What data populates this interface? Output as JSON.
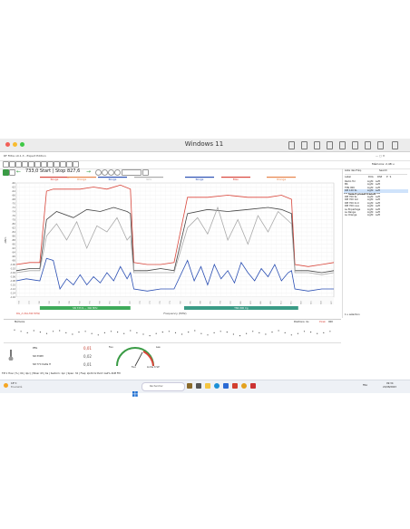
{
  "mac": {
    "title": "Windows 11",
    "menu_status": "Windows 11"
  },
  "app": {
    "title_left": "RF Filtre v0.1.3 - Expert Edition",
    "freq_controls": "733,0 Start | Stop 827,6",
    "top_right": "Mémoire: 2,48 u",
    "color_labels": [
      "Rouge",
      "Orange",
      "Rouge",
      "Gris",
      "Rouge",
      "Bleu",
      "Orange"
    ]
  },
  "chart": {
    "ylabel": "dBm",
    "xlabel": "Frequency (MHz)",
    "bottom_left_label": "RG_A (RA-M4 MHz)",
    "green_bar_1": "SN 733 R..., 340 MHz",
    "green_bar_2": "TNS 800 Cg",
    "yticks": [
      "-60",
      "-62",
      "-64",
      "-66",
      "-68",
      "-70",
      "-72",
      "-74",
      "-76",
      "-78",
      "-80",
      "-82",
      "-84",
      "-86",
      "-88",
      "-90",
      "-92",
      "-94",
      "-96",
      "-98",
      "-100",
      "-102",
      "-104",
      "-106",
      "-108",
      "-110",
      "-112",
      "-114",
      "-116"
    ]
  },
  "chart_data": {
    "type": "line",
    "xlabel": "Frequency (MHz)",
    "ylabel": "dBm",
    "ylim": [
      -116,
      -60
    ],
    "xlim": [
      733,
      827.6
    ],
    "series": [
      {
        "color": "#d9453a",
        "values": [
          [
            733,
            -100
          ],
          [
            737,
            -99
          ],
          [
            740,
            -99
          ],
          [
            742,
            -64
          ],
          [
            744,
            -63
          ],
          [
            748,
            -63
          ],
          [
            752,
            -63
          ],
          [
            756,
            -62
          ],
          [
            760,
            -63
          ],
          [
            764,
            -61
          ],
          [
            767,
            -63
          ],
          [
            768,
            -99
          ],
          [
            772,
            -100
          ],
          [
            776,
            -100
          ],
          [
            780,
            -99
          ],
          [
            784,
            -67
          ],
          [
            790,
            -67
          ],
          [
            796,
            -66
          ],
          [
            802,
            -67
          ],
          [
            808,
            -67
          ],
          [
            812,
            -66
          ],
          [
            815,
            -68
          ],
          [
            816,
            -100
          ],
          [
            820,
            -101
          ],
          [
            824,
            -100
          ],
          [
            827.6,
            -99
          ]
        ]
      },
      {
        "color": "#444444",
        "values": [
          [
            733,
            -103
          ],
          [
            737,
            -102
          ],
          [
            740,
            -102
          ],
          [
            742,
            -78
          ],
          [
            745,
            -74
          ],
          [
            750,
            -77
          ],
          [
            754,
            -73
          ],
          [
            758,
            -74
          ],
          [
            762,
            -72
          ],
          [
            766,
            -74
          ],
          [
            767,
            -75
          ],
          [
            768,
            -103
          ],
          [
            772,
            -103
          ],
          [
            776,
            -102
          ],
          [
            780,
            -103
          ],
          [
            784,
            -75
          ],
          [
            790,
            -73
          ],
          [
            796,
            -74
          ],
          [
            802,
            -73
          ],
          [
            808,
            -72
          ],
          [
            812,
            -73
          ],
          [
            815,
            -75
          ],
          [
            816,
            -103
          ],
          [
            820,
            -103
          ],
          [
            824,
            -104
          ],
          [
            827.6,
            -103
          ]
        ]
      },
      {
        "color": "#aaaaaa",
        "values": [
          [
            733,
            -104
          ],
          [
            737,
            -103
          ],
          [
            740,
            -103
          ],
          [
            742,
            -86
          ],
          [
            745,
            -80
          ],
          [
            748,
            -88
          ],
          [
            751,
            -79
          ],
          [
            754,
            -92
          ],
          [
            757,
            -81
          ],
          [
            760,
            -84
          ],
          [
            763,
            -77
          ],
          [
            766,
            -88
          ],
          [
            767,
            -86
          ],
          [
            768,
            -104
          ],
          [
            772,
            -104
          ],
          [
            776,
            -104
          ],
          [
            780,
            -104
          ],
          [
            784,
            -82
          ],
          [
            787,
            -77
          ],
          [
            790,
            -85
          ],
          [
            793,
            -72
          ],
          [
            796,
            -88
          ],
          [
            799,
            -78
          ],
          [
            802,
            -90
          ],
          [
            805,
            -76
          ],
          [
            808,
            -84
          ],
          [
            811,
            -74
          ],
          [
            815,
            -80
          ],
          [
            816,
            -104
          ],
          [
            820,
            -104
          ],
          [
            824,
            -105
          ],
          [
            827.6,
            -104
          ]
        ]
      },
      {
        "color": "#2b4fb3",
        "values": [
          [
            733,
            -108
          ],
          [
            736,
            -107
          ],
          [
            740,
            -108
          ],
          [
            742,
            -97
          ],
          [
            744,
            -98
          ],
          [
            746,
            -112
          ],
          [
            748,
            -107
          ],
          [
            750,
            -110
          ],
          [
            752,
            -105
          ],
          [
            754,
            -110
          ],
          [
            756,
            -106
          ],
          [
            758,
            -109
          ],
          [
            760,
            -104
          ],
          [
            762,
            -108
          ],
          [
            764,
            -101
          ],
          [
            766,
            -107
          ],
          [
            767,
            -104
          ],
          [
            768,
            -112
          ],
          [
            772,
            -113
          ],
          [
            776,
            -112
          ],
          [
            780,
            -112
          ],
          [
            784,
            -98
          ],
          [
            786,
            -108
          ],
          [
            788,
            -101
          ],
          [
            790,
            -110
          ],
          [
            792,
            -100
          ],
          [
            794,
            -107
          ],
          [
            796,
            -103
          ],
          [
            798,
            -109
          ],
          [
            800,
            -99
          ],
          [
            802,
            -104
          ],
          [
            804,
            -108
          ],
          [
            806,
            -102
          ],
          [
            808,
            -106
          ],
          [
            810,
            -100
          ],
          [
            812,
            -108
          ],
          [
            814,
            -104
          ],
          [
            815,
            -103
          ],
          [
            816,
            -112
          ],
          [
            820,
            -113
          ],
          [
            824,
            -112
          ],
          [
            827.6,
            -112
          ]
        ]
      }
    ]
  },
  "strip": {
    "title": "Mémoire",
    "right_label_1": "Positions: 4u",
    "right_label_2": "Pxiek",
    "right_label_3": "000"
  },
  "bottom": {
    "left_labels": [
      "PEG",
      "SN 330M",
      "SN 77C Delta H"
    ],
    "values": [
      "0,01",
      "0,02",
      "0,01"
    ],
    "gauge_left": "Feu",
    "gauge_right": "Lee",
    "gauge_bottom": "Feu",
    "gauge_bottom_right": "Linha ti SP",
    "status_bar": "TM 1 Hour (% | 04 | 4pc) | Mixer 43 | Ka | Saxtom: 1pc | Span: 32 | Freq: 2p24 hz Pulct 1a4% 2bM FM"
  },
  "panel": {
    "title_a": "Liste des Fréq.",
    "title_b": "Search",
    "headers": [
      "Label",
      "DUA",
      "DSP",
      "P",
      "S"
    ],
    "rows": [
      {
        "label": "Radio Tol",
        "a": "Light",
        "b": "Left"
      },
      {
        "label": "BS",
        "a": "Light",
        "b": "Left"
      },
      {
        "label": "TNS 900",
        "a": "Light",
        "b": "Left"
      },
      {
        "label": "RM 120 SL",
        "a": "Light",
        "b": "Left"
      },
      {
        "label": "RM 700 SL",
        "a": "Light",
        "b": "Left"
      },
      {
        "label": "RM 700 1st",
        "a": "Light",
        "b": "Left"
      },
      {
        "label": "RM 700 2nd",
        "a": "Light",
        "b": "Left"
      },
      {
        "label": "RM 700 Live",
        "a": "Light",
        "b": "Left"
      },
      {
        "label": "Le Enpartage",
        "a": "Light",
        "b": "Left"
      },
      {
        "label": "Le Range",
        "a": "Light",
        "b": "Left"
      },
      {
        "label": "Le Orange",
        "a": "Light",
        "b": "Left"
      }
    ],
    "highlight_row": "*** Select preset transit ***",
    "footer": "1 u sélection"
  },
  "taskbar": {
    "weather_temp": "18°C",
    "weather_desc": "Ensoleillé",
    "search": "Rechercher",
    "time": "09:34",
    "date": "21/08/2023",
    "lang": "FRA"
  }
}
